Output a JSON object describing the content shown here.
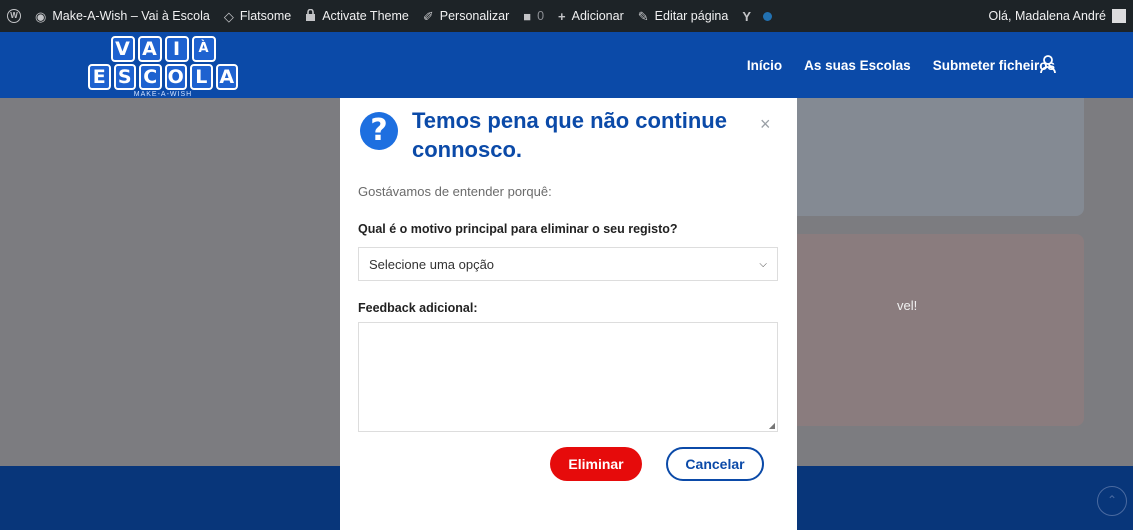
{
  "adminbar": {
    "wp_logo": "W",
    "site_name": "Make-A-Wish – Vai à Escola",
    "theme": "Flatsome",
    "activate": "Activate Theme",
    "customize": "Personalizar",
    "comments_count": "0",
    "add_new": "Adicionar",
    "edit_page": "Editar página",
    "greeting": "Olá, Madalena André"
  },
  "logo": {
    "row1": [
      "V",
      "A",
      "I",
      "À"
    ],
    "row2": [
      "E",
      "S",
      "C",
      "O",
      "L",
      "A"
    ],
    "sub": "MAKE-A-WISH"
  },
  "nav": {
    "home": "Início",
    "schools": "As suas Escolas",
    "submit": "Submeter ficheiros"
  },
  "background": {
    "card_fragment": "vel!"
  },
  "modal": {
    "icon": "?",
    "title": "Temos pena que não continue connosco.",
    "close": "×",
    "subtitle": "Gostávamos de entender porquê:",
    "reason_label": "Qual é o motivo principal para eliminar o seu registo?",
    "reason_placeholder": "Selecione uma opção",
    "feedback_label": "Feedback adicional:",
    "delete_label": "Eliminar",
    "cancel_label": "Cancelar"
  },
  "colors": {
    "brand_blue": "#0b4aa8",
    "danger_red": "#e60b0b",
    "adminbar_bg": "#1d2327"
  }
}
